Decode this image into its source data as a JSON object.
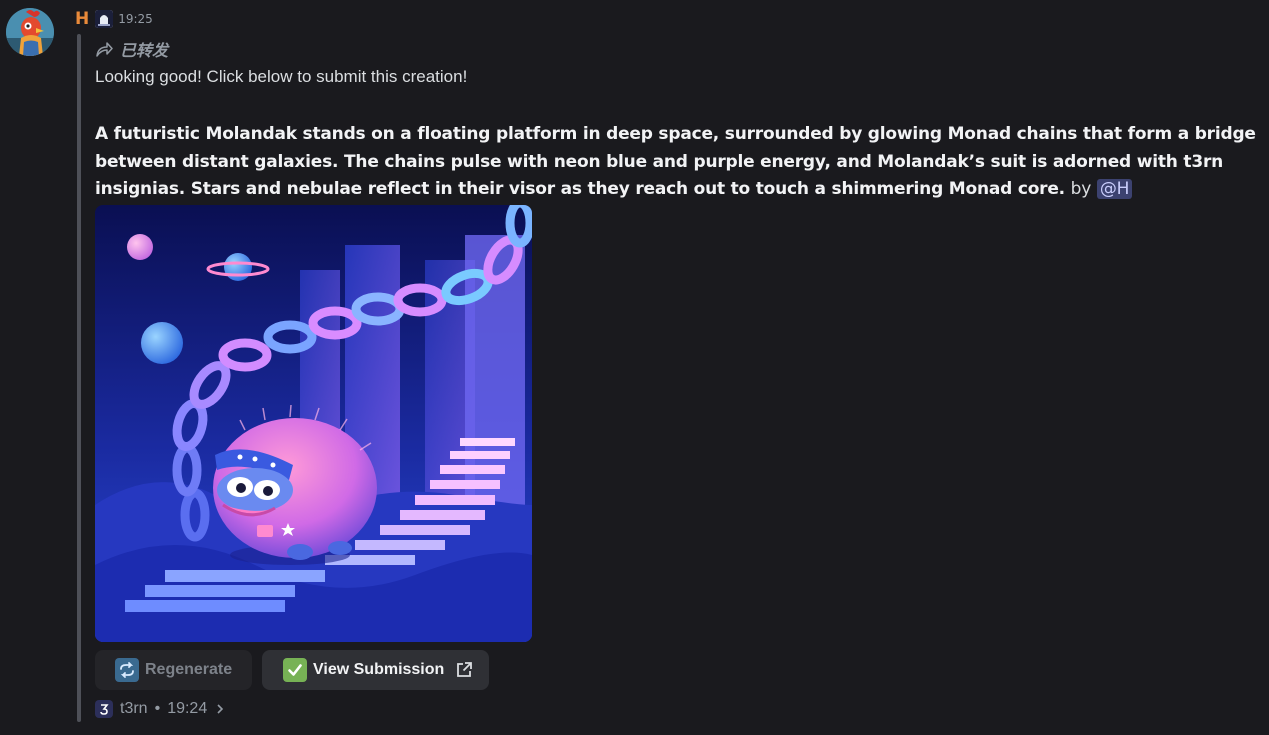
{
  "author": {
    "name": "H",
    "time": "19:25",
    "avatar_icon": "rooster-avatar",
    "name_color": "#e98a3a"
  },
  "forwarded_label": "已转发",
  "message": {
    "intro": "Looking good! Click below to submit this creation!",
    "prompt": "A futuristic Molandak stands on a floating platform in deep space, surrounded by glowing Monad chains that form a bridge between distant galaxies. The chains pulse with neon blue and purple energy, and Molandak’s suit is adorned with t3rn insignias. Stars and nebulae reflect in their visor as they reach out to touch a shimmering Monad core.",
    "by_label": "by",
    "mention": "@H"
  },
  "buttons": {
    "regenerate": {
      "label": "Regenerate",
      "icon": "repeat-emoji-icon"
    },
    "view_submission": {
      "label": "View Submission",
      "icon": "check-mark-emoji-icon",
      "trailing_icon": "external-link-icon"
    }
  },
  "footer": {
    "app_name": "t3rn",
    "separator": "•",
    "time": "19:24"
  },
  "colors": {
    "background": "#1a1a1e",
    "quote_bar": "#4e5058",
    "mention_bg": "#3c4270",
    "mention_fg": "#c9cdfb"
  }
}
